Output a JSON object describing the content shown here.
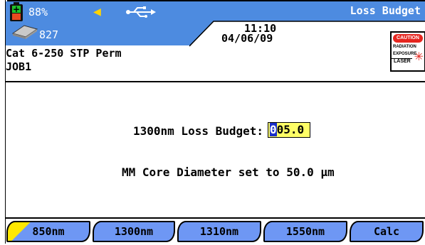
{
  "status": {
    "battery_percent": "88%",
    "memory_count": "827",
    "screen_title": "Loss Budget",
    "time": "11:10",
    "date": "04/06/09",
    "icons": [
      "battery-icon",
      "speaker-icon",
      "usb-icon",
      "memory-icon",
      "laser-caution-icon"
    ]
  },
  "caution_label": {
    "heading": "CAUTION",
    "line1": "RADIATION",
    "line2": "EXPOSURE",
    "line3": "LASER"
  },
  "test": {
    "name": "Cat 6-250 STP Perm",
    "job": "JOB1"
  },
  "main": {
    "loss_budget_label": "1300nm Loss Budget:",
    "loss_budget_cursor": "0",
    "loss_budget_rest": "05.0",
    "core_diameter_text": "MM Core Diameter set to 50.0 μm"
  },
  "softkeys": [
    "850nm",
    "1300nm",
    "1310nm",
    "1550nm",
    "Calc"
  ],
  "colors": {
    "status_bar": "#4d8be0",
    "softkey": "#6e97f4",
    "input_highlight": "#ffff66",
    "cursor": "#1a2fc9",
    "softkey_indicator": "#ffe800"
  }
}
